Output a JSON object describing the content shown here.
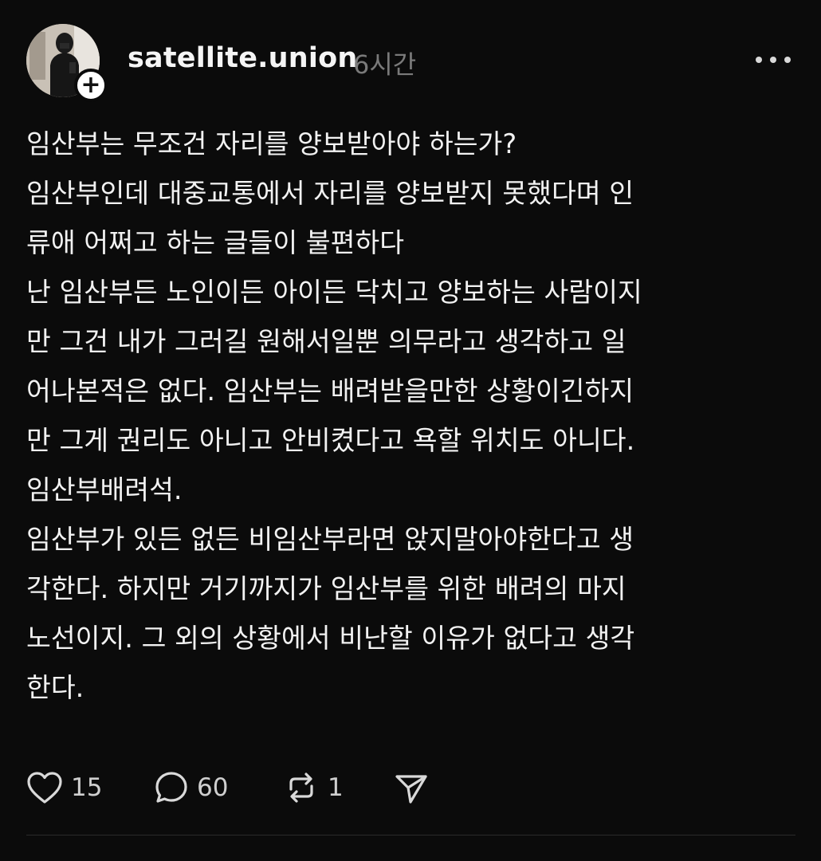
{
  "post": {
    "username": "satellite.union",
    "time": "6시간",
    "avatar_icon": "profile-photo",
    "follow_icon": "plus-icon",
    "follow_symbol": "+",
    "paragraphs": [
      "임산부는 무조건 자리를 양보받아야 하는가?",
      "임산부인데 대중교통에서 자리를 양보받지 못했다며 인\n류애 어쩌고 하는 글들이 불편하다",
      "난 임산부든 노인이든 아이든 닥치고 양보하는 사람이지\n만 그건 내가 그러길 원해서일뿐 의무라고 생각하고 일\n어나본적은 없다.  임산부는 배려받을만한 상황이긴하지\n만 그게 권리도 아니고 안비켰다고 욕할 위치도 아니다.",
      "임산부배려석.",
      "임산부가 있든 없든 비임산부라면 앉지말아야한다고 생\n각한다.  하지만 거기까지가 임산부를 위한 배려의 마지\n노선이지.  그 외의 상황에서 비난할 이유가 없다고 생각\n한다."
    ]
  },
  "actions": {
    "like_count": "15",
    "comment_count": "60",
    "repost_count": "1",
    "like_icon": "heart-icon",
    "comment_icon": "comment-icon",
    "repost_icon": "repost-icon",
    "share_icon": "send-icon"
  },
  "colors": {
    "background": "#0b0b0b",
    "text": "#f2f2f2",
    "muted": "#7a7a7a"
  }
}
